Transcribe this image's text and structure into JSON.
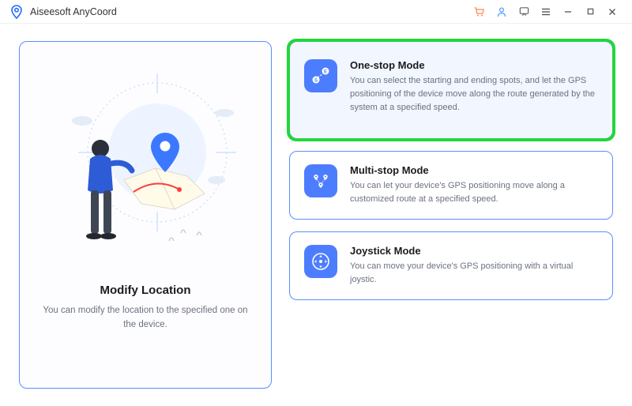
{
  "app": {
    "title": "Aiseesoft AnyCoord"
  },
  "left": {
    "title": "Modify Location",
    "desc": "You can modify the location to the specified one on the device."
  },
  "modes": {
    "onestop": {
      "title": "One-stop Mode",
      "desc": "You can select the starting and ending spots, and let the GPS positioning of the device move along the route generated by the system at a specified speed."
    },
    "multistop": {
      "title": "Multi-stop Mode",
      "desc": "You can let your device's GPS positioning move along a customized route at a specified speed."
    },
    "joystick": {
      "title": "Joystick Mode",
      "desc": "You can move your device's GPS positioning with a virtual joystic."
    }
  }
}
